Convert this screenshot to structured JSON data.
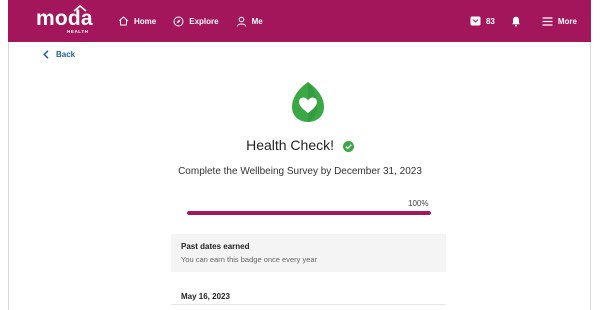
{
  "colors": {
    "brand": "#a3165c",
    "accent_green": "#3aa845",
    "link": "#1f5fa8"
  },
  "header": {
    "logo_text": "moda",
    "logo_sub": "HEALTH",
    "nav": [
      {
        "label": "Home",
        "icon": "home-icon"
      },
      {
        "label": "Explore",
        "icon": "compass-icon"
      },
      {
        "label": "Me",
        "icon": "person-icon"
      }
    ],
    "messages_count": "83",
    "more_label": "More"
  },
  "back_label": "Back",
  "badge": {
    "icon": "heart-leaf-icon",
    "title": "Health Check!",
    "subtitle": "Complete the Wellbeing Survey by December 31, 2023",
    "progress_percent": 100,
    "progress_label": "100%"
  },
  "past_dates": {
    "title": "Past dates earned",
    "description": "You can earn this badge once every year",
    "dates": [
      "May 16, 2023"
    ]
  }
}
